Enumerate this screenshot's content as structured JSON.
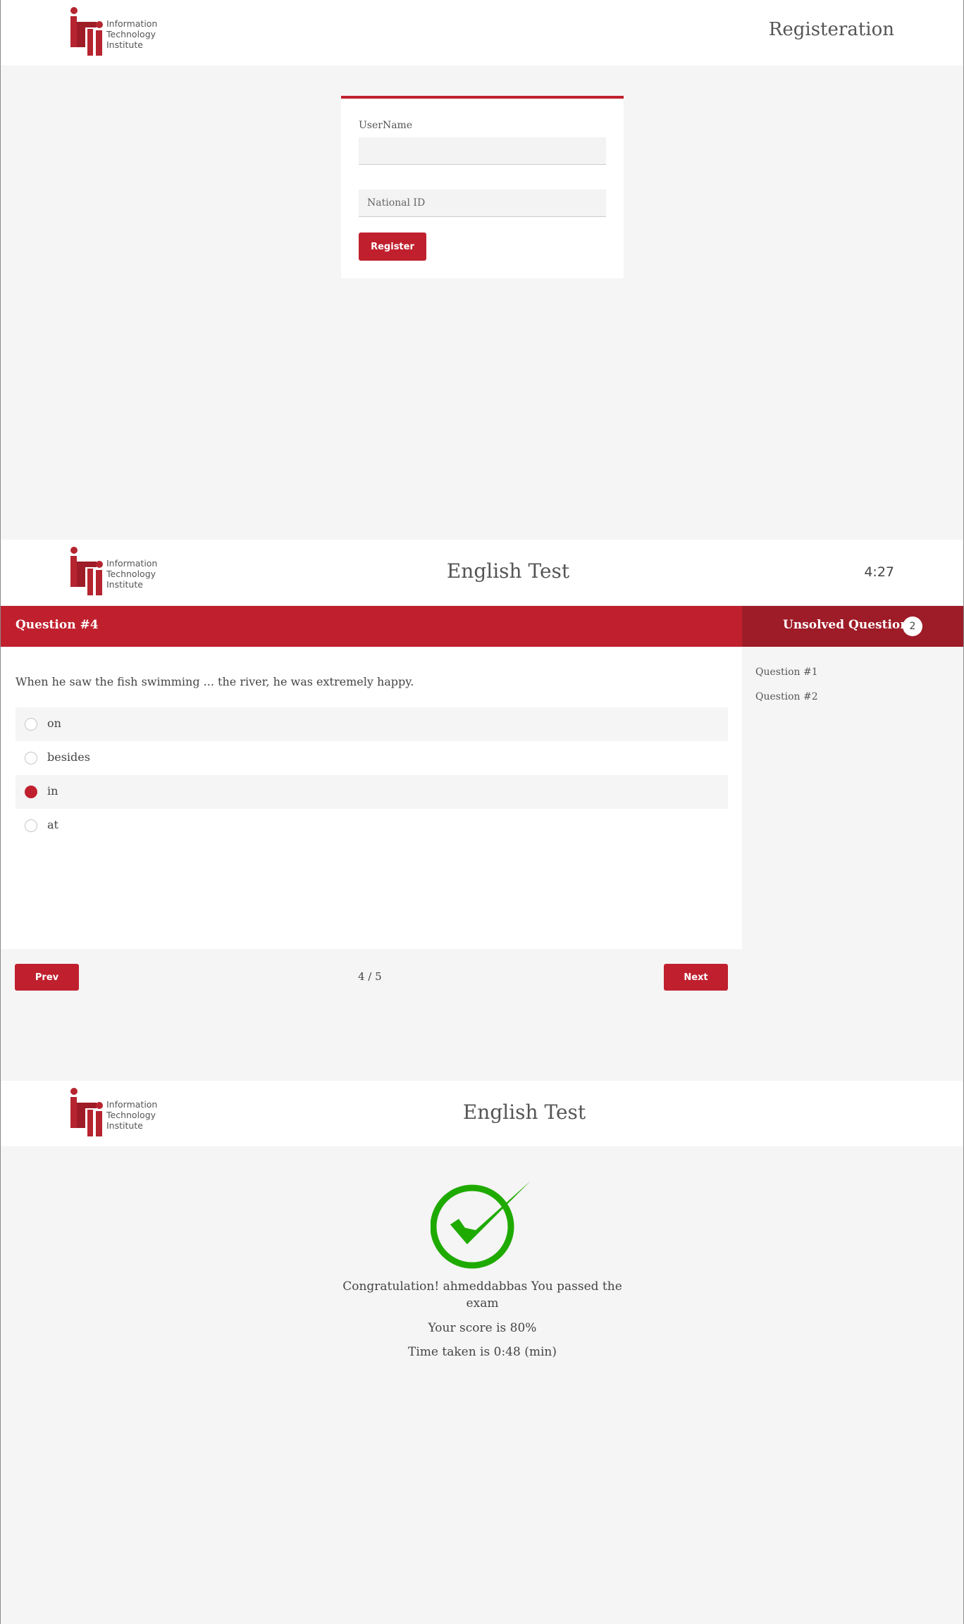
{
  "logo": {
    "lines": [
      "Information",
      "Technology",
      "Institute"
    ]
  },
  "registration": {
    "title": "Registeration",
    "username_label": "UserName",
    "username_value": "",
    "national_id_placeholder": "National ID",
    "register_button": "Register"
  },
  "exam": {
    "title": "English Test",
    "timer": "4:27",
    "question_header": "Question #4",
    "question_text": "When he saw the fish swimming ... the river, he was extremely happy.",
    "options": [
      {
        "label": "on",
        "selected": false
      },
      {
        "label": "besides",
        "selected": false
      },
      {
        "label": "in",
        "selected": true
      },
      {
        "label": "at",
        "selected": false
      }
    ],
    "unsolved_label": "Unsolved Questions",
    "unsolved_count": "2",
    "unsolved_items": [
      "Question #1",
      "Question #2"
    ],
    "prev_button": "Prev",
    "next_button": "Next",
    "pager": "4 / 5"
  },
  "result": {
    "title": "English Test",
    "message": "Congratulation! ahmeddabbas You passed the exam",
    "score": "Your score is 80%",
    "time_taken": "Time taken is 0:48 (min)",
    "check_color": "#1faa00"
  },
  "colors": {
    "brand_red": "#c0202e",
    "dark_red": "#9e1c27",
    "background": "#f5f5f5"
  }
}
